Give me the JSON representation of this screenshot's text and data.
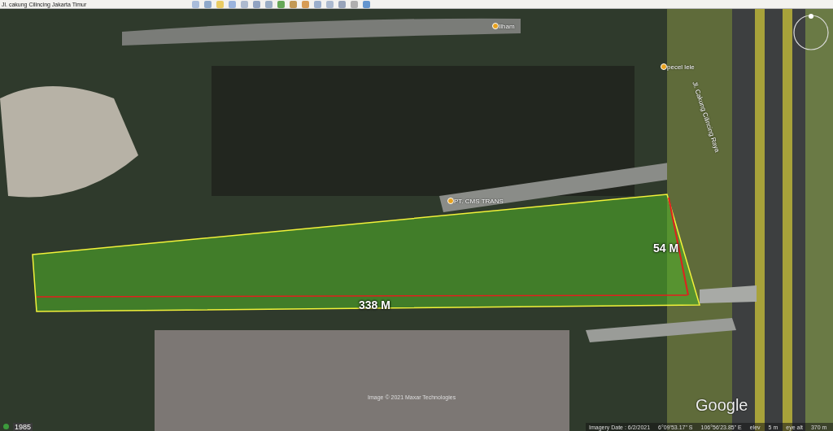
{
  "toolbar": {
    "place_title": "Jl. cakung Cilincing Jakarta Timur"
  },
  "map": {
    "labels": [
      {
        "kind": "poi",
        "text": "Ilham"
      },
      {
        "kind": "poi",
        "text": "pecel lele"
      },
      {
        "kind": "road",
        "text": "Jl. Cakung Cilincing Raya"
      },
      {
        "kind": "poi",
        "text": "PT. CMS TRANS"
      }
    ],
    "measurements": [
      {
        "text": "338 M"
      },
      {
        "text": "54 M"
      }
    ],
    "credit": "Image © 2021 Maxar Technologies",
    "google_logo": "Google",
    "history_year": "1985"
  },
  "status_bar": {
    "imagery_date": "Imagery Date : 6/2/2021",
    "latitude": "6°09'53.17\" S",
    "longitude": "106°56'23.85\" E",
    "elev_label": "elev",
    "elev": "5 m",
    "eye_alt_label": "eye alt",
    "eye_alt": "370 m"
  }
}
